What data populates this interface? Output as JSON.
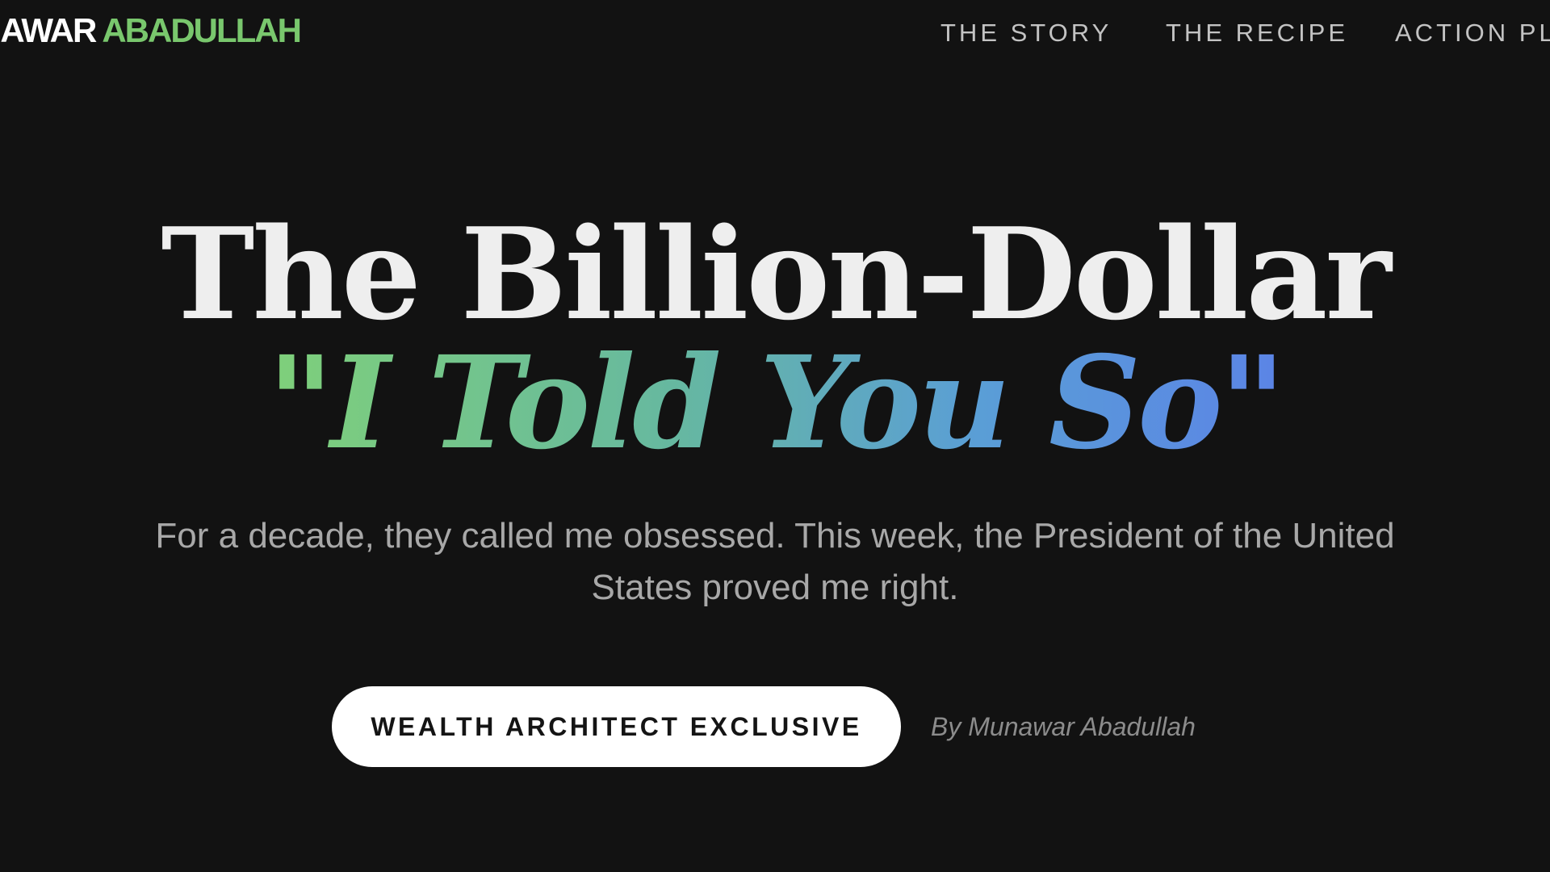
{
  "header": {
    "logo_first": "NAWAR",
    "logo_last": "ABADULLAH",
    "nav": [
      {
        "label": "THE STORY"
      },
      {
        "label": "THE RECIPE"
      },
      {
        "label": "ACTION PL"
      }
    ]
  },
  "hero": {
    "title": "The Billion-Dollar",
    "subtitle": "\"I Told You So\"",
    "lead": "For a decade, they called me obsessed. This week, the President of the United States proved me right.",
    "cta_label": "WEALTH ARCHITECT EXCLUSIVE",
    "byline": "By Munawar Abadullah"
  },
  "colors": {
    "background": "#121212",
    "logo_accent": "#79c76d",
    "gradient_start": "#7fd07a",
    "gradient_end": "#5b84e6",
    "cta_background": "#ffffff"
  }
}
